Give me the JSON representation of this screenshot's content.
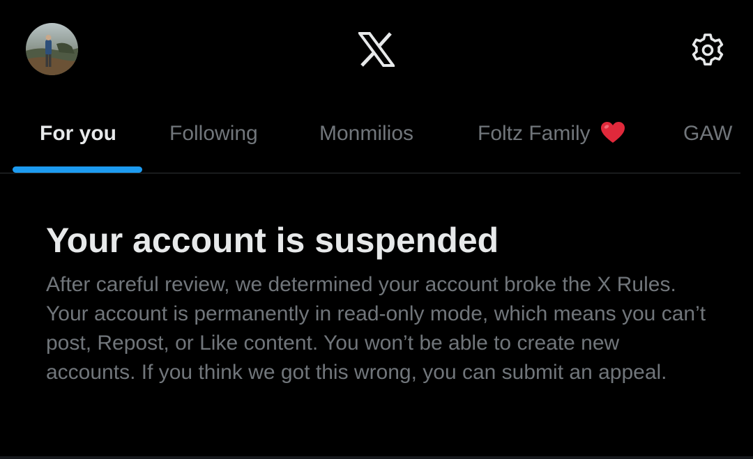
{
  "header": {
    "avatar_icon": "profile-photo",
    "logo_icon": "x-logo-icon",
    "settings_icon": "gear-icon"
  },
  "tabs": [
    {
      "label": "For you",
      "active": true
    },
    {
      "label": "Following",
      "active": false
    },
    {
      "label": "Monmilios",
      "active": false
    },
    {
      "label": "Foltz Family",
      "active": false,
      "emoji": "❤️"
    },
    {
      "label": "GAW",
      "active": false
    }
  ],
  "notice": {
    "title": "Your account is suspended",
    "body": "After careful review, we determined your account broke the X Rules. Your account is permanently in read-only mode, which means you can’t post, Repost, or Like content. You won’t be able to create new accounts. If you think we got this wrong, you can submit an appeal."
  },
  "colors": {
    "background": "#000000",
    "primary_text": "#e7e9ea",
    "secondary_text": "#71767b",
    "accent": "#1d9bf0",
    "divider": "#2f3336"
  }
}
